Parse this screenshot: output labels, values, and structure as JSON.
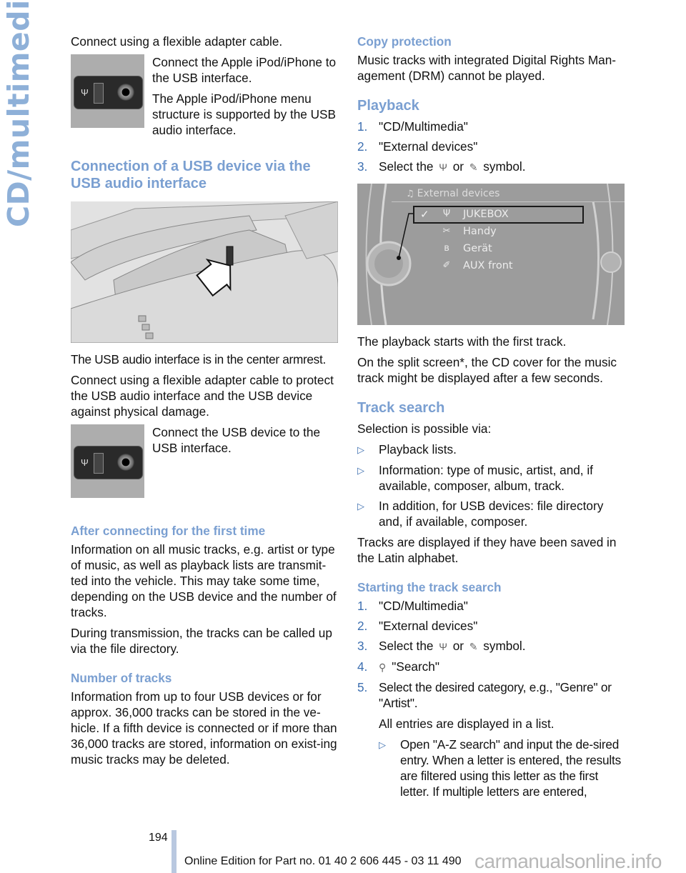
{
  "side_label": "CD/multimedia",
  "left": {
    "intro": "Connect using a flexible adapter cable.",
    "ipod_fig_text1": "Connect the Apple iPod/iPhone to the USB interface.",
    "ipod_fig_text2": "The Apple iPod/iPhone menu structure is supported by the USB audio interface.",
    "port_image_labels": {
      "usb": "USB",
      "aux": "AUX-IN"
    },
    "heading_usb": "Connection of a USB device via the USB audio interface",
    "armrest_caption": "The USB audio interface is in the center armrest.",
    "protect_text": "Connect using a flexible adapter cable to protect the USB audio interface and the USB device against physical damage.",
    "usb_fig_text": "Connect the USB device to the USB interface.",
    "heading_first_time": "After connecting for the first time",
    "first_time_text": "Information on all music tracks, e.g. artist or type of music, as well as playback lists are transmit-ted into the vehicle. This may take some time, depending on the USB device and the number of tracks.",
    "transmission_text": "During transmission, the tracks can be called up via the file directory.",
    "heading_number": "Number of tracks",
    "number_text": "Information from up to four USB devices or for approx. 36,000 tracks can be stored in the ve-hicle. If a fifth device is connected or if more than 36,000 tracks are stored, information on exist-ing music tracks may be deleted."
  },
  "right": {
    "heading_copy": "Copy protection",
    "copy_text": "Music tracks with integrated Digital Rights Man-agement (DRM) cannot be played.",
    "heading_playback": "Playback",
    "playback_steps": [
      {
        "num": "1.",
        "text": "\"CD/Multimedia\""
      },
      {
        "num": "2.",
        "text": "\"External devices\""
      },
      {
        "num": "3.",
        "pre": "Select the",
        "mid": "or",
        "post": "symbol."
      }
    ],
    "screen": {
      "title": "External devices",
      "items": [
        {
          "label": "JUKEBOX",
          "icon": "usb-icon",
          "glyph": "Ψ",
          "checked": true
        },
        {
          "label": "Handy",
          "icon": "phone-icon",
          "glyph": "✂"
        },
        {
          "label": "Gerät",
          "icon": "bluetooth-icon",
          "glyph": "ʙ"
        },
        {
          "label": "AUX front",
          "icon": "aux-plug-icon",
          "glyph": "✐"
        }
      ],
      "check_glyph": "✓"
    },
    "playback_start": "The playback starts with the first track.",
    "split_screen": "On the split screen*, the CD cover for the music track might be displayed after a few seconds.",
    "heading_track_search": "Track search",
    "selection_intro": "Selection is possible via:",
    "selection_bullets": [
      "Playback lists.",
      "Information: type of music, artist, and, if available, composer, album, track.",
      "In addition, for USB devices: file directory and, if available, composer."
    ],
    "latin_text": "Tracks are displayed if they have been saved in the Latin alphabet.",
    "heading_starting": "Starting the track search",
    "search_steps": [
      {
        "num": "1.",
        "text": "\"CD/Multimedia\""
      },
      {
        "num": "2.",
        "text": "\"External devices\""
      },
      {
        "num": "3.",
        "pre": "Select the",
        "mid": "or",
        "post": "symbol."
      },
      {
        "num": "4.",
        "text": "\"Search\""
      },
      {
        "num": "5.",
        "text": "Select the desired category, e.g., \"Genre\" or \"Artist\"."
      }
    ],
    "entries_text": "All entries are displayed in a list.",
    "az_bullet": "Open \"A-Z search\" and input the de-sired entry. When a letter is entered, the results are filtered using this letter as the first letter. If multiple letters are entered,"
  },
  "footer": {
    "page_number": "194",
    "edition": "Online Edition for Part no. 01 40 2 606 445 - 03 11 490",
    "watermark": "carmanualsonline.info"
  },
  "colors": {
    "heading": "#7a9fd1",
    "list_marker": "#3d6fb0",
    "side_label": "#8eb0d8",
    "footer_bar": "#b9c8e0"
  }
}
